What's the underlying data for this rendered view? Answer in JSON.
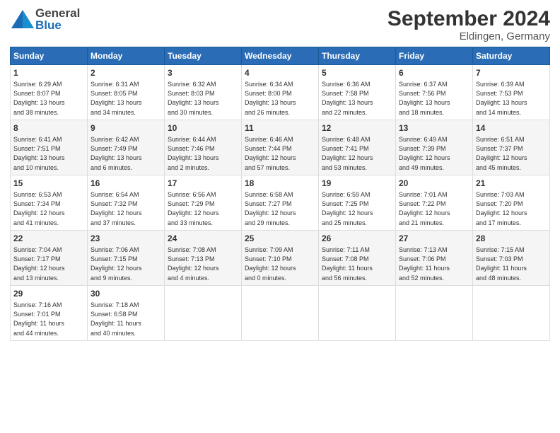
{
  "header": {
    "logo_general": "General",
    "logo_blue": "Blue",
    "title": "September 2024",
    "subtitle": "Eldingen, Germany"
  },
  "calendar": {
    "days_of_week": [
      "Sunday",
      "Monday",
      "Tuesday",
      "Wednesday",
      "Thursday",
      "Friday",
      "Saturday"
    ],
    "weeks": [
      [
        {
          "day": "",
          "info": ""
        },
        {
          "day": "2",
          "info": "Sunrise: 6:31 AM\nSunset: 8:05 PM\nDaylight: 13 hours\nand 34 minutes."
        },
        {
          "day": "3",
          "info": "Sunrise: 6:32 AM\nSunset: 8:03 PM\nDaylight: 13 hours\nand 30 minutes."
        },
        {
          "day": "4",
          "info": "Sunrise: 6:34 AM\nSunset: 8:00 PM\nDaylight: 13 hours\nand 26 minutes."
        },
        {
          "day": "5",
          "info": "Sunrise: 6:36 AM\nSunset: 7:58 PM\nDaylight: 13 hours\nand 22 minutes."
        },
        {
          "day": "6",
          "info": "Sunrise: 6:37 AM\nSunset: 7:56 PM\nDaylight: 13 hours\nand 18 minutes."
        },
        {
          "day": "7",
          "info": "Sunrise: 6:39 AM\nSunset: 7:53 PM\nDaylight: 13 hours\nand 14 minutes."
        }
      ],
      [
        {
          "day": "8",
          "info": "Sunrise: 6:41 AM\nSunset: 7:51 PM\nDaylight: 13 hours\nand 10 minutes."
        },
        {
          "day": "9",
          "info": "Sunrise: 6:42 AM\nSunset: 7:49 PM\nDaylight: 13 hours\nand 6 minutes."
        },
        {
          "day": "10",
          "info": "Sunrise: 6:44 AM\nSunset: 7:46 PM\nDaylight: 13 hours\nand 2 minutes."
        },
        {
          "day": "11",
          "info": "Sunrise: 6:46 AM\nSunset: 7:44 PM\nDaylight: 12 hours\nand 57 minutes."
        },
        {
          "day": "12",
          "info": "Sunrise: 6:48 AM\nSunset: 7:41 PM\nDaylight: 12 hours\nand 53 minutes."
        },
        {
          "day": "13",
          "info": "Sunrise: 6:49 AM\nSunset: 7:39 PM\nDaylight: 12 hours\nand 49 minutes."
        },
        {
          "day": "14",
          "info": "Sunrise: 6:51 AM\nSunset: 7:37 PM\nDaylight: 12 hours\nand 45 minutes."
        }
      ],
      [
        {
          "day": "15",
          "info": "Sunrise: 6:53 AM\nSunset: 7:34 PM\nDaylight: 12 hours\nand 41 minutes."
        },
        {
          "day": "16",
          "info": "Sunrise: 6:54 AM\nSunset: 7:32 PM\nDaylight: 12 hours\nand 37 minutes."
        },
        {
          "day": "17",
          "info": "Sunrise: 6:56 AM\nSunset: 7:29 PM\nDaylight: 12 hours\nand 33 minutes."
        },
        {
          "day": "18",
          "info": "Sunrise: 6:58 AM\nSunset: 7:27 PM\nDaylight: 12 hours\nand 29 minutes."
        },
        {
          "day": "19",
          "info": "Sunrise: 6:59 AM\nSunset: 7:25 PM\nDaylight: 12 hours\nand 25 minutes."
        },
        {
          "day": "20",
          "info": "Sunrise: 7:01 AM\nSunset: 7:22 PM\nDaylight: 12 hours\nand 21 minutes."
        },
        {
          "day": "21",
          "info": "Sunrise: 7:03 AM\nSunset: 7:20 PM\nDaylight: 12 hours\nand 17 minutes."
        }
      ],
      [
        {
          "day": "22",
          "info": "Sunrise: 7:04 AM\nSunset: 7:17 PM\nDaylight: 12 hours\nand 13 minutes."
        },
        {
          "day": "23",
          "info": "Sunrise: 7:06 AM\nSunset: 7:15 PM\nDaylight: 12 hours\nand 9 minutes."
        },
        {
          "day": "24",
          "info": "Sunrise: 7:08 AM\nSunset: 7:13 PM\nDaylight: 12 hours\nand 4 minutes."
        },
        {
          "day": "25",
          "info": "Sunrise: 7:09 AM\nSunset: 7:10 PM\nDaylight: 12 hours\nand 0 minutes."
        },
        {
          "day": "26",
          "info": "Sunrise: 7:11 AM\nSunset: 7:08 PM\nDaylight: 11 hours\nand 56 minutes."
        },
        {
          "day": "27",
          "info": "Sunrise: 7:13 AM\nSunset: 7:06 PM\nDaylight: 11 hours\nand 52 minutes."
        },
        {
          "day": "28",
          "info": "Sunrise: 7:15 AM\nSunset: 7:03 PM\nDaylight: 11 hours\nand 48 minutes."
        }
      ],
      [
        {
          "day": "29",
          "info": "Sunrise: 7:16 AM\nSunset: 7:01 PM\nDaylight: 11 hours\nand 44 minutes."
        },
        {
          "day": "30",
          "info": "Sunrise: 7:18 AM\nSunset: 6:58 PM\nDaylight: 11 hours\nand 40 minutes."
        },
        {
          "day": "",
          "info": ""
        },
        {
          "day": "",
          "info": ""
        },
        {
          "day": "",
          "info": ""
        },
        {
          "day": "",
          "info": ""
        },
        {
          "day": "",
          "info": ""
        }
      ]
    ],
    "week1_day1": {
      "day": "1",
      "info": "Sunrise: 6:29 AM\nSunset: 8:07 PM\nDaylight: 13 hours\nand 38 minutes."
    }
  }
}
